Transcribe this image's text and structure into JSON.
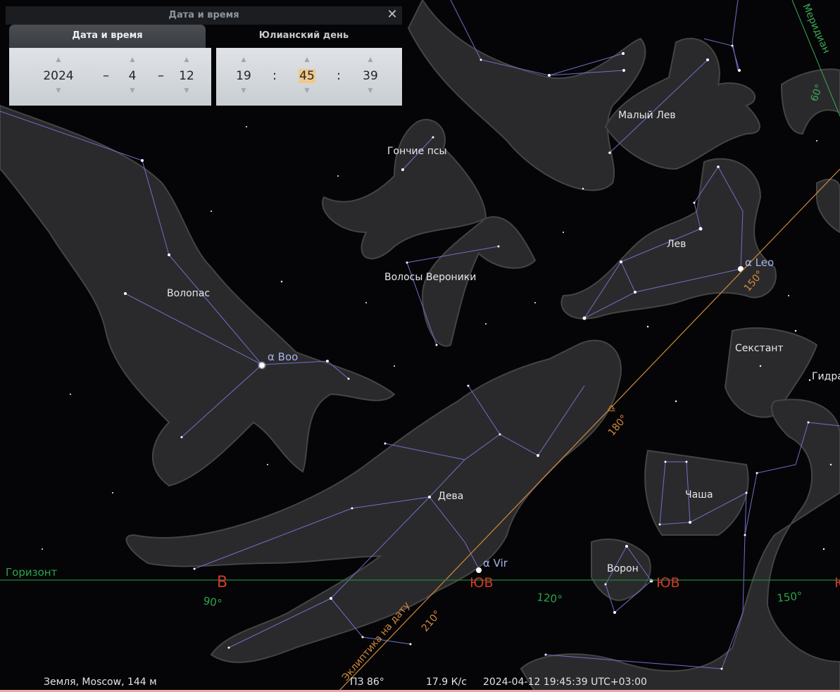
{
  "dialog": {
    "title": "Дата и время",
    "tabs": [
      "Дата и время",
      "Юлианский день"
    ],
    "date": {
      "year": "2024",
      "month": "4",
      "day": "12"
    },
    "time": {
      "hour": "19",
      "minute": "45",
      "second": "39"
    },
    "date_separator": "–",
    "time_separator": ":",
    "close_icon": "close-icon"
  },
  "constellations": {
    "maly_lev": "Малый Лев",
    "gonchie_psy": "Гончие псы",
    "lev": "Лев",
    "volosy_veroniki": "Волосы Вероники",
    "volopas": "Волопас",
    "sekstant": "Секстант",
    "gidra": "Гидра",
    "chasha": "Чаша",
    "deva": "Дева",
    "voron": "Ворон"
  },
  "stars": {
    "alpha_boo": "α Boo",
    "alpha_leo": "α Leo",
    "alpha_vir": "α Vir"
  },
  "horizon": {
    "label": "Горизонт",
    "cardinals": [
      "В",
      "ЮВ",
      "ЮВ",
      "Ю"
    ],
    "degrees": [
      "90°",
      "120°",
      "150°"
    ]
  },
  "ecliptic": {
    "label": "Эклиптика на дату",
    "degrees": [
      "150°",
      "180°",
      "210°"
    ],
    "libra_symbol": "♎"
  },
  "meridian": {
    "label": "Меридиан",
    "degree": "60°"
  },
  "status_bar": {
    "location": "Земля, Moscow, 144 м",
    "fov": "ПЗ 86°",
    "fps": "17.9 К/с",
    "datetime": "2024-04-12 19:45:39 UTC+03:00"
  },
  "colors": {
    "horizon": "#1d8a36",
    "cardinal": "#d13a2a",
    "ecliptic": "#d08a3c",
    "constellation_lines": "#6f70c8",
    "meridian": "#3aaa55"
  }
}
